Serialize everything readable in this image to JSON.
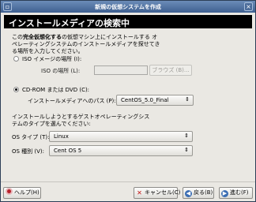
{
  "window": {
    "title": "新規の仮想システムを作成"
  },
  "header": {
    "title": "インストールメディアの検索中"
  },
  "description": {
    "line1_prefix": "この",
    "line1_bold": "完全仮想化する",
    "line1_suffix": "の仮想マシン上にインストールする オ",
    "line2": "ペレーティングシステムのインストールメディアを探せてき",
    "line3": "る場所を入力してください。"
  },
  "iso_option": {
    "label": "ISO イメージの場所 (I):",
    "location_label": "ISO の場所 (L):",
    "location_value": "",
    "browse_label": "ブラウズ (B)..."
  },
  "cdrom_option": {
    "label": "CD-ROM または DVD (C):",
    "path_label": "インストールメディアへのパス (P):",
    "path_value": "CentOS_5.0_Final"
  },
  "guest_info": {
    "line1": "インストールしようとするゲストオペレーティングシス",
    "line2": "テムのタイプを選んでください:"
  },
  "os_type": {
    "label": "OS タイプ (T):",
    "value": "Linux"
  },
  "os_variant": {
    "label": "OS 種別 (V):",
    "value": "Cent OS 5"
  },
  "buttons": {
    "help": "ヘルプ(H)",
    "cancel": "キャンセル(C)",
    "back": "戻る(B)",
    "next": "進む(F)"
  }
}
